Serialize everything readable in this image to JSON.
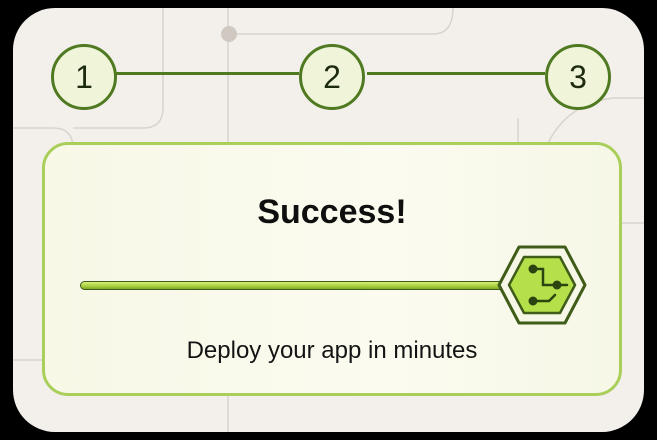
{
  "stepper": {
    "steps": [
      {
        "label": "1"
      },
      {
        "label": "2"
      },
      {
        "label": "3"
      }
    ],
    "current_step": 3
  },
  "status_card": {
    "title": "Success!",
    "subtitle": "Deploy your app in minutes",
    "progress_fraction": 1.0
  },
  "colors": {
    "accent": "#4f7a22",
    "accent_light": "#a9cf5a",
    "knob_fill": "#b6e04a"
  },
  "icons": {
    "knob": "circuit-hexagon-icon"
  }
}
